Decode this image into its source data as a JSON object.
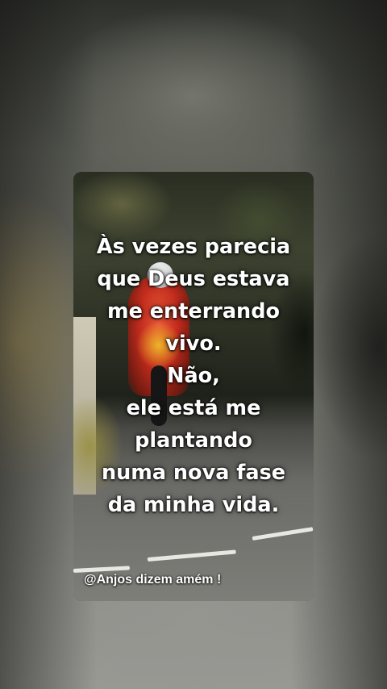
{
  "quote": {
    "lines": [
      "Às vezes parecia",
      "que Deus estava",
      "me enterrando",
      "vivo.",
      "Não,",
      "ele está me",
      "plantando",
      "numa nova fase",
      "da minha vida."
    ]
  },
  "watermark": "@Anjos dizem amém !",
  "colors": {
    "text": "#ffffff",
    "road_line": "#e8e8e2",
    "rider_red": "#d12a1c",
    "bike_yellow": "#f0c828"
  }
}
